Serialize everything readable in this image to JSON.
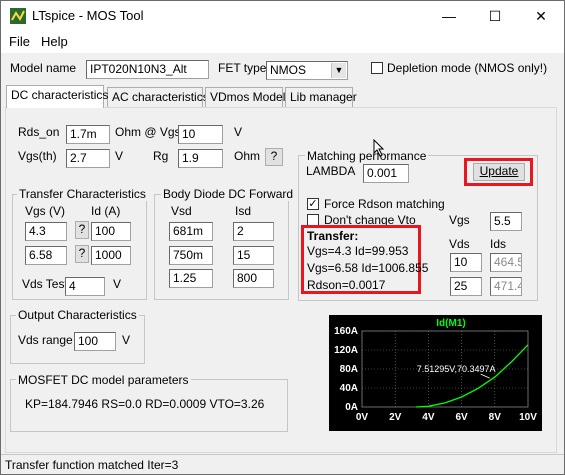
{
  "window": {
    "title": "LTspice - MOS Tool",
    "minimize": "—",
    "maximize": "☐",
    "close": "✕"
  },
  "menu": {
    "file": "File",
    "help": "Help"
  },
  "header": {
    "model_name_label": "Model name",
    "model_name_value": "IPT020N10N3_Alt",
    "fet_type_label": "FET type",
    "fet_type_value": "NMOS",
    "depletion_label": "Depletion mode (NMOS only!)"
  },
  "tabs": [
    "DC characteristics",
    "AC characteristics",
    "VDmos Model",
    "Lib manager"
  ],
  "params": {
    "rds_on_label": "Rds_on",
    "rds_on_value": "1.7m",
    "ohm_at_vgs_label": "Ohm @ Vgs=",
    "vgs_value": "10",
    "v_unit": "V",
    "vgs_th_label": "Vgs(th)",
    "vgs_th_value": "2.7",
    "v_unit2": "V",
    "rg_label": "Rg",
    "rg_value": "1.9",
    "ohm_label": "Ohm",
    "help_btn": "?"
  },
  "transfer": {
    "title": "Transfer Characteristics",
    "vgs_header": "Vgs (V)",
    "id_header": "Id (A)",
    "rows": [
      {
        "vgs": "4.3",
        "id": "100",
        "btn": "?"
      },
      {
        "vgs": "6.58",
        "id": "1000",
        "btn": "?"
      }
    ],
    "vds_test_label": "Vds Test",
    "vds_test_value": "4",
    "v_unit": "V"
  },
  "diode": {
    "title": "Body Diode DC Forward",
    "vsd_header": "Vsd",
    "isd_header": "Isd",
    "rows": [
      {
        "vsd": "681m",
        "isd": "2"
      },
      {
        "vsd": "750m",
        "isd": "15"
      },
      {
        "vsd": "1.25",
        "isd": "800"
      }
    ]
  },
  "matching": {
    "title": "Matching performance",
    "lambda_label": "LAMBDA",
    "lambda_value": "0.001",
    "update_button": "Update",
    "force_rdson_label": "Force Rdson matching",
    "dont_change_vto_label": "Don't change Vto",
    "result_title": "Transfer:",
    "result_line1": "Vgs=4.3 Id=99.953",
    "result_line2": "Vgs=6.58 Id=1006.855",
    "result_line3": "Rdson=0.0017",
    "vgs_label": "Vgs",
    "vgs_value": "5.5",
    "vds_label": "Vds",
    "ids_label": "Ids",
    "vds1": "10",
    "ids1": "464.5",
    "vds2": "25",
    "ids2": "471.4"
  },
  "output": {
    "title": "Output Characteristics",
    "vds_range_label": "Vds range",
    "vds_range_value": "100",
    "v_unit": "V"
  },
  "model": {
    "title": "MOSFET DC model parameters",
    "params_text": "KP=184.7946 RS=0.0 RD=0.0009 VTO=3.26"
  },
  "status": {
    "text": "Transfer function matched Iter=3"
  },
  "chart_data": {
    "type": "line",
    "title": "Id(M1)",
    "x_ticks": [
      "0V",
      "2V",
      "4V",
      "6V",
      "8V",
      "10V"
    ],
    "y_ticks": [
      "0A",
      "40A",
      "80A",
      "120A",
      "160A"
    ],
    "xlim": [
      0,
      10
    ],
    "ylim": [
      0,
      160
    ],
    "series": [
      {
        "name": "Id(M1)",
        "color": "#00ff00",
        "x": [
          3.26,
          4,
          5,
          6,
          7,
          7.51,
          8,
          9,
          10
        ],
        "y": [
          0,
          1.5,
          8.6,
          21,
          39.4,
          70.35,
          63,
          95,
          131
        ]
      }
    ],
    "annotation": "7.51295V,70.3497A",
    "colors": {
      "background": "#000000",
      "grid": "#808080",
      "axis_text": "#ffffff",
      "curve": "#00ff00"
    }
  }
}
